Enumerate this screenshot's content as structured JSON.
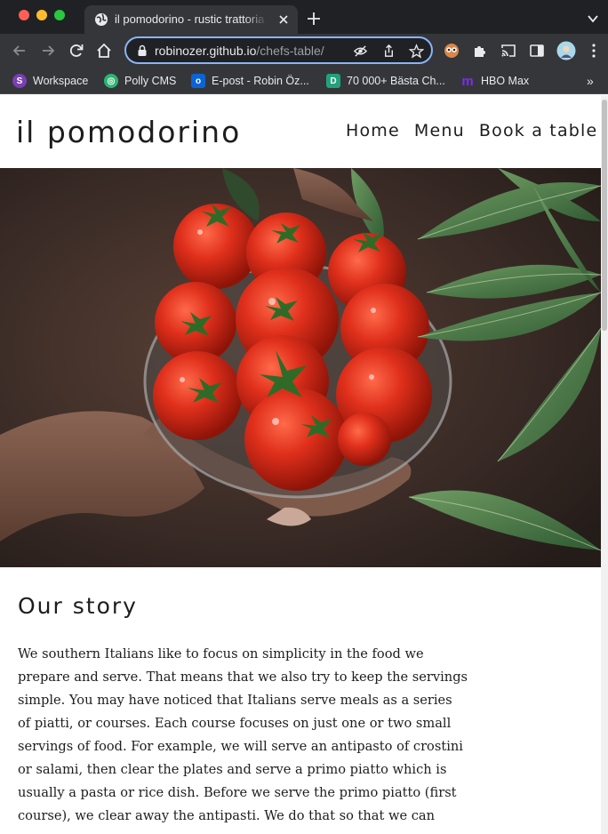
{
  "browser": {
    "tab": {
      "title": "il pomodorino - rustic trattoria",
      "favicon": "globe-icon"
    },
    "address_bar": {
      "host": "robinozer.github.io",
      "path": "/chefs-table/"
    },
    "bookmarks": [
      {
        "label": "Workspace",
        "icon": "workspace-icon",
        "color": "#7b3fb3"
      },
      {
        "label": "Polly CMS",
        "icon": "polly-icon",
        "color": "#2bb673"
      },
      {
        "label": "E-post - Robin Öz...",
        "icon": "outlook-icon",
        "color": "#0a64d6"
      },
      {
        "label": "70 000+ Bästa Ch...",
        "icon": "d-icon",
        "color": "#22a27a"
      },
      {
        "label": "HBO Max",
        "icon": "hbo-max-icon",
        "color": "#7b2cf5"
      }
    ],
    "accent_color": "#8ab4f8"
  },
  "site": {
    "logo": "il pomodorino",
    "nav": [
      {
        "label": "Home"
      },
      {
        "label": "Menu"
      },
      {
        "label": "Book a table"
      }
    ],
    "hero": {
      "subject": "hands holding a glass bowl of red tomatoes beside green leaves"
    },
    "story": {
      "title": "Our story",
      "lines": [
        "We southern Italians like to focus on simplicity in the food we",
        "prepare and serve. That means that we also try to keep the servings",
        "simple. You may have noticed that Italians serve meals as a series",
        "of piatti, or courses. Each course focuses on just one or two small",
        "servings of food. For example, we will serve an antipasto of crostini",
        "or salami, then clear the plates and serve a primo piatto which is",
        "usually a pasta or rice dish. Before we serve the primo piatto (first",
        "course), we clear away the antipasti. We do that so that we can"
      ]
    }
  }
}
